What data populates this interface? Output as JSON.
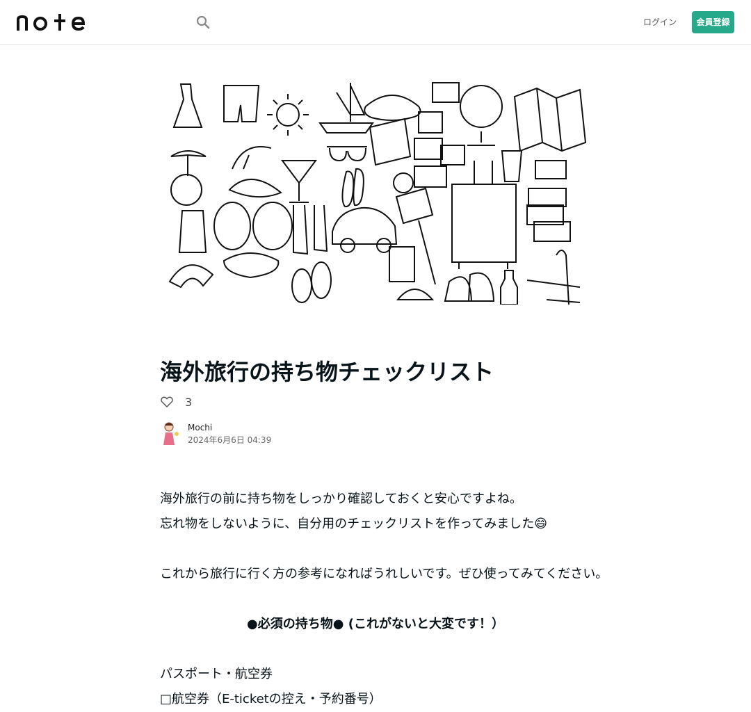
{
  "header": {
    "logo_text": "note",
    "login_label": "ログイン",
    "signup_label": "会員登録"
  },
  "article": {
    "title": "海外旅行の持ち物チェックリスト",
    "like_count": "3",
    "author_name": "Mochi",
    "date": "2024年6月6日 04:39",
    "paragraphs": [
      "海外旅行の前に持ち物をしっかり確認しておくと安心ですよね。",
      "忘れ物をしないように、自分用のチェックリストを作ってみました😄",
      "",
      "これから旅行に行く方の参考になればうれしいです。ぜひ使ってみてください。",
      "",
      "●必須の持ち物● (これがないと大変です！）",
      "",
      "パスポート・航空券",
      "□航空券（E-ticketの控え・予約番号）"
    ]
  },
  "icons": {
    "search": "search-icon",
    "like": "heart-icon"
  },
  "colors": {
    "accent": "#26a98a",
    "text": "#08131a"
  }
}
